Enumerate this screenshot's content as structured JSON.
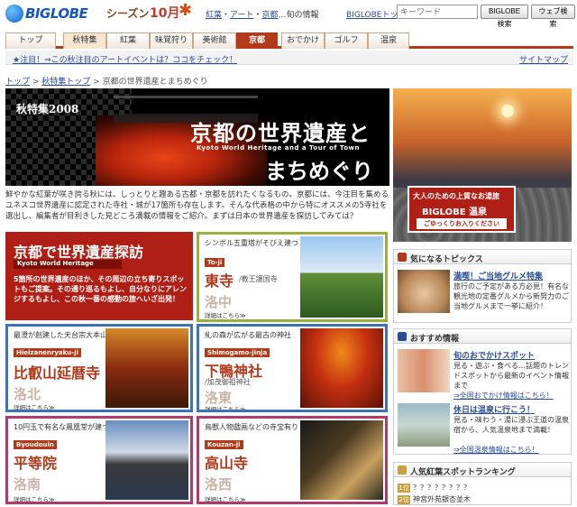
{
  "header": {
    "logo": "BIGLOBE",
    "season_label": "シーズン",
    "month_label": "10月",
    "crumbs": [
      "紅葉",
      "アート",
      "京都"
    ],
    "crumbs_tail": "…旬の情報",
    "biglobe_top": "BIGLOBEトップ",
    "keyword_placeholder": "キーワード",
    "biglobe_search": "BIGLOBE検索",
    "web_search": "ウェブ検索"
  },
  "tabs": [
    "トップ",
    "秋特集",
    "紅葉",
    "味覚狩り",
    "美術館",
    "京都",
    "おでかけ",
    "ゴルフ",
    "温泉"
  ],
  "active_tab": "京都",
  "notice": {
    "text": "★注目！⇒この秋注目のアートイベントは？ココをチェック！",
    "sitemap": "サイトマップ"
  },
  "breadcrumbs": [
    "トップ",
    "秋特集トップ",
    "京都の世界遺産とまちめぐり"
  ],
  "hero": {
    "kicker": "秋特集2008",
    "title1": "京都の世界遺産と",
    "subtitle": "Kyoto World Heritage and a Tour of Town",
    "title2": "まちめぐり"
  },
  "intro": "鮮やかな紅葉が咲き誇る秋には、しっとりと趣ある古都・京都を訪れたくなるもの。京都には、今注目を集めるユネスコ世界遺産に認定された寺社・城が17箇所も存在します。そんな代表格の中から特にオススメの5寺社を選出し、編集者が目利きした見どころ満載の情報をご紹介。まずは日本の世界遺産を探訪してみては？",
  "feature": {
    "title": "京都で世界遺産探訪",
    "subtitle": "Kyoto World Heritage",
    "body": "5箇所の世界遺産のほか、その周辺の立ち寄りスポットもご提案。その通り巡るもよし、自分なりにアレンジするもよし、この秋一番の感動の旅へいざ出発！"
  },
  "spots": [
    {
      "caption": "シンボル五重塔がそびえ建つ",
      "roman": "To-ji",
      "name": "東寺",
      "sub": "/教王護国寺",
      "area": "洛中",
      "more": "詳細はこちら≫"
    },
    {
      "caption": "最澄が創建した天台宗大本山",
      "roman": "Hieizanenryaku-ji",
      "name": "比叡山延暦寺",
      "sub": "",
      "area": "洛北",
      "more": "詳細はこちら≫"
    },
    {
      "caption": "糺の森が広がる最古の神社",
      "roman": "Shimogamo-jinja",
      "name": "下鴨神社",
      "sub": "/加茂御祖神社",
      "area": "洛東",
      "more": "詳細はこちら≫"
    },
    {
      "caption": "10円玉で有名な鳳凰堂が建つ",
      "roman": "Byoudouin",
      "name": "平等院",
      "sub": "",
      "area": "洛南",
      "more": "詳細はこちら≫"
    },
    {
      "caption": "鳥獣人物戯画などの寺宝有り",
      "roman": "Kouzan-ji",
      "name": "高山寺",
      "sub": "",
      "area": "洛西",
      "more": "詳細はこちら≫"
    }
  ],
  "ad": {
    "line1": "大人のための上質なお湯旅",
    "brand": "BIGLOBE 温泉",
    "cta": "ごゆっくりお入りください"
  },
  "topics": {
    "heading": "気になるトピックス",
    "title": "満喫！ご当地グルメ特集",
    "text": "旅行のご予定がある方必見！有名な観光地の定番グルメから新努力のご当地グルメまで一挙に紹介！"
  },
  "recommend": {
    "heading": "おすすめ情報",
    "items": [
      {
        "title": "旬のおでかけスポット",
        "text": "見る・遊ぶ・食べる…話題のトレンドスポットから最新のイベント情報まで",
        "link": "⇒全国おでかけ情報はこちら！"
      },
      {
        "title": "休日は温泉に行こう！",
        "text": "見る・味わう・湯に浸ぶ王道の温泉宿から、人気温泉地まで満載！",
        "link": "⇒全国温泉情報はこちら！"
      }
    ]
  },
  "ranking": {
    "heading": "人気紅葉スポットランキング",
    "rows": [
      {
        "rank": "1位",
        "text": "？？？？？？？？"
      },
      {
        "rank": "2位",
        "text": "神宮外苑銀杏並木"
      }
    ]
  },
  "colors": {
    "accent": "#b23a1a",
    "link": "#2a4d9a",
    "feature_bg": "#b01f15"
  }
}
